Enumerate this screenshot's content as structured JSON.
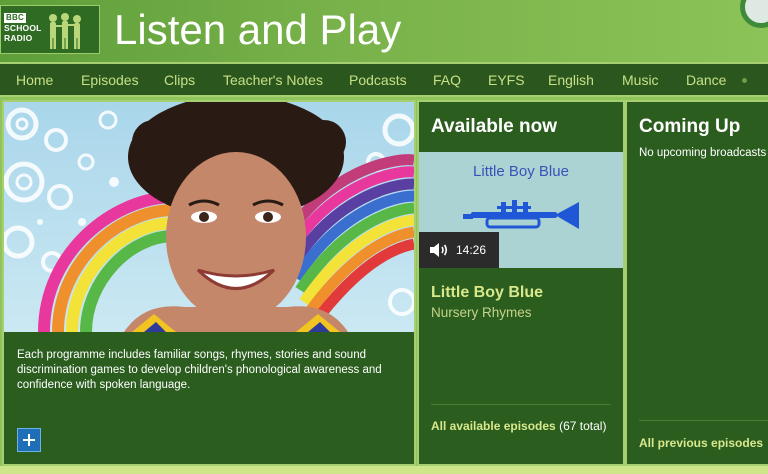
{
  "header": {
    "logo": {
      "line1": "BBC",
      "line2": "SCHOOL",
      "line3": "RADIO"
    },
    "title": "Listen and Play"
  },
  "nav": {
    "items": [
      "Home",
      "Episodes",
      "Clips",
      "Teacher's Notes",
      "Podcasts",
      "FAQ",
      "EYFS",
      "English",
      "Music",
      "Dance"
    ]
  },
  "hero": {
    "description": "Each programme includes familiar songs, rhymes, stories and sound discrimination games to develop children's phonological awareness and confidence with spoken language."
  },
  "available": {
    "heading": "Available now",
    "thumb_title": "Little Boy Blue",
    "duration": "14:26",
    "episode_title": "Little Boy Blue",
    "episode_subtitle": "Nursery Rhymes",
    "all_link": "All available episodes",
    "all_count": "(67 total)"
  },
  "coming": {
    "heading": "Coming Up",
    "none_text": "No upcoming broadcasts",
    "prev_link": "All previous episodes"
  },
  "colors": {
    "panel_bg": "#2b5d1f",
    "nav_text": "#c6e087",
    "link_accent": "#d8e88c",
    "trumpet_blue": "#1f57d6"
  },
  "icons": [
    "bbc-school-radio-logo",
    "trumpet-icon",
    "speaker-icon",
    "plus-icon"
  ]
}
